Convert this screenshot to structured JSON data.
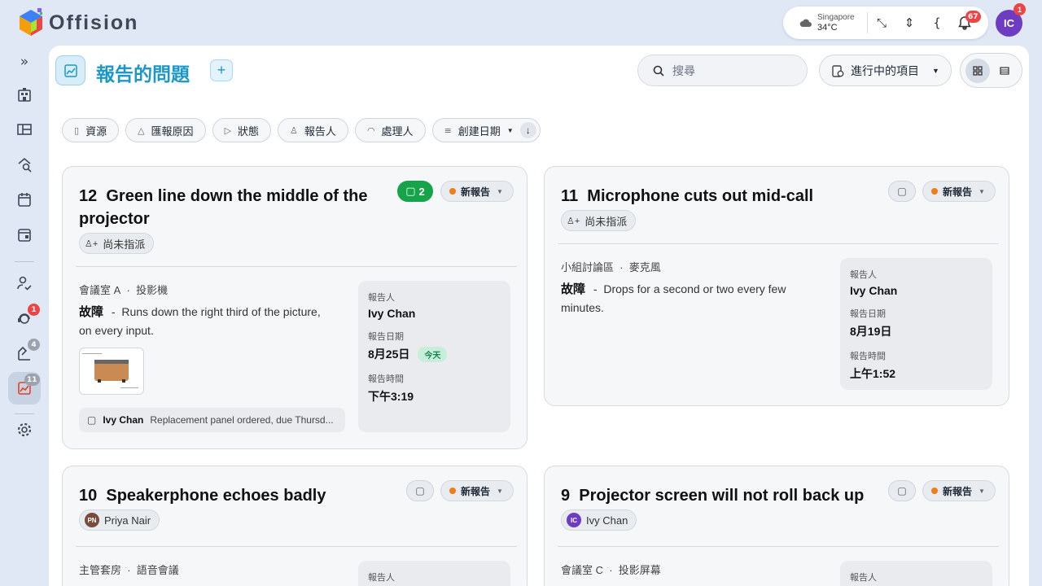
{
  "app": {
    "name": "Offision"
  },
  "weather": {
    "city": "Singapore",
    "temp": "34°C"
  },
  "notifications": {
    "count": "67"
  },
  "user": {
    "initials": "IC",
    "badge": "1"
  },
  "sidebar": {
    "badges": {
      "support": "1",
      "maintenance": "4",
      "issues": "11"
    }
  },
  "page": {
    "title": "報告的問題"
  },
  "search": {
    "placeholder": "搜尋"
  },
  "project_filter": {
    "label": "進行中的項目"
  },
  "filters": [
    {
      "label": "資源"
    },
    {
      "label": "匯報原因"
    },
    {
      "label": "狀態"
    },
    {
      "label": "報告人"
    },
    {
      "label": "處理人"
    },
    {
      "label": "創建日期"
    }
  ],
  "cards": [
    {
      "id": "12",
      "title": "Green line down the middle of the projector",
      "comment_count": "2",
      "status": "新報告",
      "assignee": "尚未指派",
      "location": "會議室 A",
      "resource": "投影機",
      "category": "故障",
      "description": "Runs down the right third of the picture, on every input.",
      "reporter_label": "報告人",
      "reporter": "Ivy Chan",
      "date_label": "報告日期",
      "date": "8月25日",
      "today": "今天",
      "time_label": "報告時間",
      "time": "下午3:19",
      "last_comment_author": "Ivy Chan",
      "last_comment": "Replacement panel ordered, due Thursd..."
    },
    {
      "id": "11",
      "title": "Microphone cuts out mid-call",
      "status": "新報告",
      "assignee": "尚未指派",
      "location": "小組討論區",
      "resource": "麥克風",
      "category": "故障",
      "description": "Drops for a second or two every few minutes.",
      "reporter_label": "報告人",
      "reporter": "Ivy Chan",
      "date_label": "報告日期",
      "date": "8月19日",
      "time_label": "報告時間",
      "time": "上午1:52"
    },
    {
      "id": "10",
      "title": "Speakerphone echoes badly",
      "status": "新報告",
      "assignee": "Priya Nair",
      "assignee_initials": "PN",
      "location": "主管套房",
      "resource": "語音會議",
      "reporter_label": "報告人"
    },
    {
      "id": "9",
      "title": "Projector screen will not roll back up",
      "status": "新報告",
      "assignee": "Ivy Chan",
      "assignee_initials": "IC",
      "location": "會議室 C",
      "resource": "投影屏幕",
      "reporter_label": "報告人"
    }
  ]
}
